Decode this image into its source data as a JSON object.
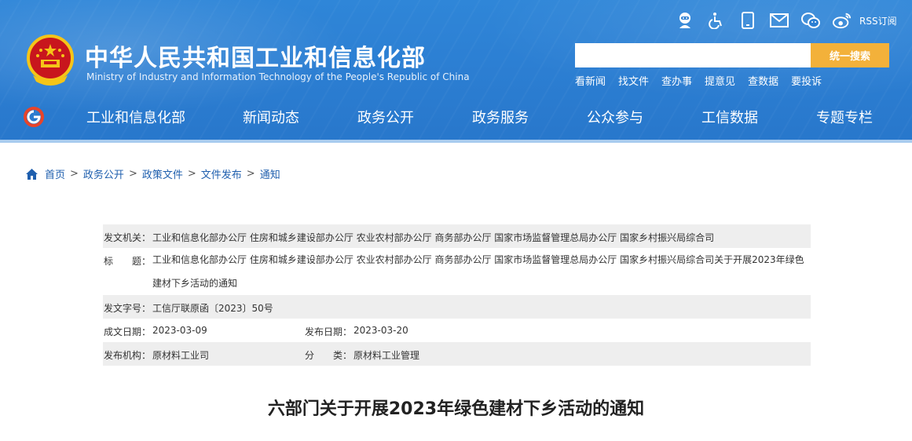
{
  "header": {
    "title": "中华人民共和国工业和信息化部",
    "subtitle": "Ministry of Industry and Information Technology of the People's Republic of China",
    "rss_label": "RSS订阅",
    "search": {
      "value": "",
      "placeholder": "",
      "button_label": "统一搜索"
    },
    "quick_links": [
      "看新闻",
      "找文件",
      "查办事",
      "提意见",
      "查数据",
      "要投诉"
    ],
    "tool_icons": [
      "ai-assistant-icon",
      "accessibility-icon",
      "mobile-icon",
      "mail-icon",
      "wechat-icon",
      "weibo-icon"
    ]
  },
  "nav": {
    "items": [
      "工业和信息化部",
      "新闻动态",
      "政务公开",
      "政务服务",
      "公众参与",
      "工信数据",
      "专题专栏"
    ]
  },
  "breadcrumb": [
    "首页",
    "政务公开",
    "政策文件",
    "文件发布",
    "通知"
  ],
  "meta": {
    "issuer_label": "发文机关：",
    "issuer": "工业和信息化部办公厅 住房和城乡建设部办公厅 农业农村部办公厅 商务部办公厅 国家市场监督管理总局办公厅 国家乡村振兴局综合司",
    "title_label": "标　　题：",
    "title": "工业和信息化部办公厅 住房和城乡建设部办公厅 农业农村部办公厅 商务部办公厅 国家市场监督管理总局办公厅 国家乡村振兴局综合司关于开展2023年绿色建材下乡活动的通知",
    "doc_no_label": "发文字号：",
    "doc_no": "工信厅联原函〔2023〕50号",
    "written_date_label": "成文日期：",
    "written_date": "2023-03-09",
    "publish_date_label": "发布日期：",
    "publish_date": "2023-03-20",
    "publisher_label": "发布机构：",
    "publisher": "原材料工业司",
    "category_label": "分　　类：",
    "category": "原材料工业管理"
  },
  "article": {
    "title": "六部门关于开展2023年绿色建材下乡活动的通知"
  },
  "colors": {
    "header_blue": "#2c7fd3",
    "search_button": "#f3b13a",
    "link_blue": "#1f5fae",
    "meta_shade": "#eeeeee"
  }
}
